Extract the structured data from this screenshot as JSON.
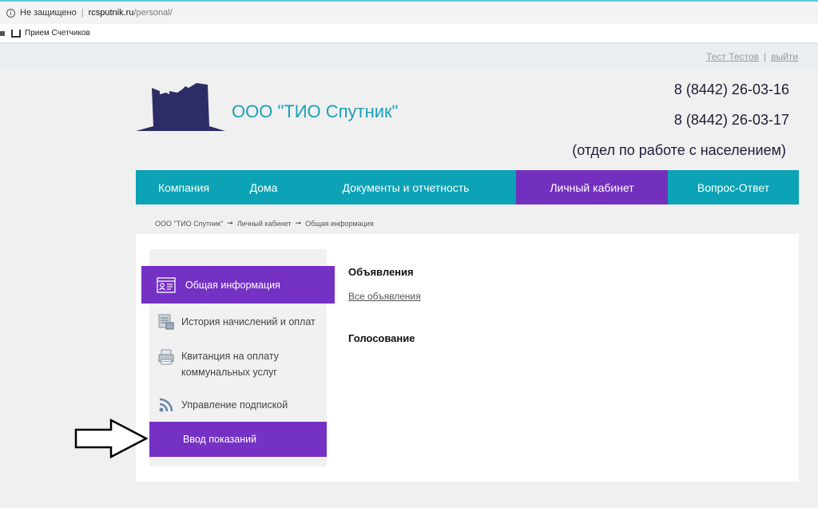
{
  "browser": {
    "security_label": "Не защищено",
    "url_domain": "rcsputnik.ru",
    "url_path": "/personal/",
    "bookmark_label": "Прием Счетчиков"
  },
  "topbar": {
    "user_name": "Тест Тестов",
    "logout_label": "выйти"
  },
  "header": {
    "company_name": "ООО \"ТИО Спутник\"",
    "phone_1": "8 (8442) 26-03-16",
    "phone_2": "8 (8442) 26-03-17",
    "department": "(отдел по работе с населением)"
  },
  "nav": {
    "items": [
      "Компания",
      "Дома",
      "Документы и отчетность",
      "Личный кабинет",
      "Вопрос-Ответ"
    ],
    "active": "Личный кабинет"
  },
  "breadcrumb": {
    "items": [
      "ООО \"ТИО Спутник\"",
      "Личный кабинет",
      "Общая информация"
    ]
  },
  "sidebar": {
    "items": [
      {
        "label": "Общая информация",
        "icon": "id-card-icon"
      },
      {
        "label": "История начислений и оплат",
        "icon": "document-table-icon"
      },
      {
        "label": "Квитанция на оплату коммунальных услуг",
        "icon": "printer-icon"
      },
      {
        "label": "Управление подпиской",
        "icon": "rss-icon"
      },
      {
        "label": "Ввод показаний",
        "icon": ""
      }
    ]
  },
  "main": {
    "announcements_title": "Объявления",
    "all_announcements_link": "Все объявления",
    "voting_title": "Голосование"
  },
  "colors": {
    "teal": "#0ba3b5",
    "purple": "#7531c4",
    "logo_navy": "#2d2d66"
  }
}
